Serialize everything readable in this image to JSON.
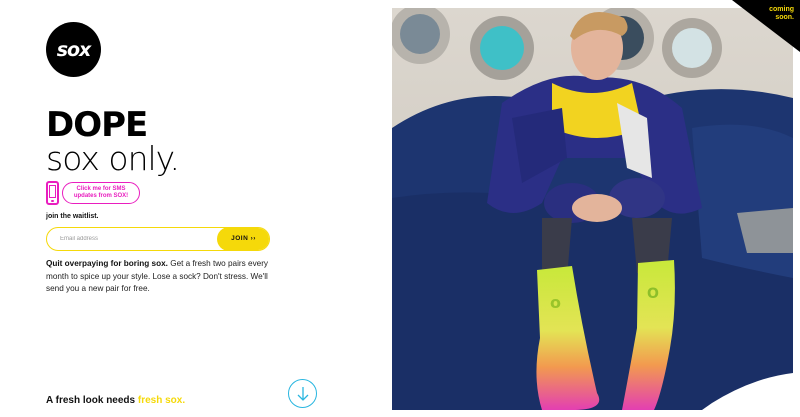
{
  "logo": {
    "text": "sox"
  },
  "headline": {
    "line1": "DOPE",
    "line2": "sox only."
  },
  "sms": {
    "button_label": "Click me for SMS updates from SOX!"
  },
  "waitlist": {
    "label": "join the waitlist.",
    "email_placeholder": "Email address",
    "join_label": "JOIN ››"
  },
  "description": {
    "bold": "Quit overpaying for boring sox.",
    "rest": " Get a fresh two pairs every month to spice up your style. Lose a sock? Don't stress. We'll send you a new pair for free."
  },
  "tagline": {
    "prefix": "A fresh look needs ",
    "accent": "fresh sox."
  },
  "corner_badge": {
    "line1": "coming",
    "line2": "soon."
  },
  "colors": {
    "accent_yellow": "#f5d90a",
    "accent_pink": "#e91ebf",
    "accent_blue": "#29b6e0",
    "black": "#000000"
  }
}
